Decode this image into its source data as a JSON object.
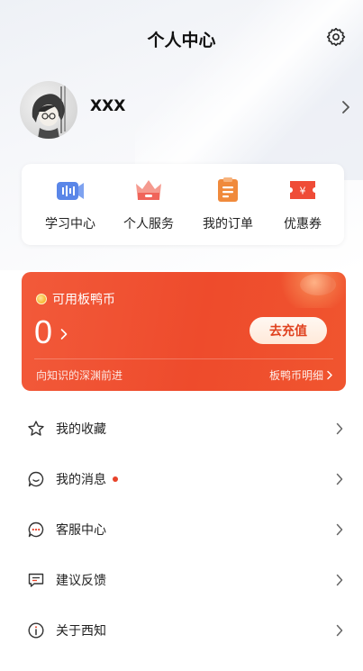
{
  "header": {
    "title": "个人中心",
    "settings_icon": "gear-icon"
  },
  "profile": {
    "username": "XXX"
  },
  "quick_actions": [
    {
      "label": "学习中心",
      "icon": "study-center-icon",
      "color": "#5a86e8"
    },
    {
      "label": "个人服务",
      "icon": "crown-icon",
      "color": "#f0645a"
    },
    {
      "label": "我的订单",
      "icon": "order-list-icon",
      "color": "#f08a3c"
    },
    {
      "label": "优惠券",
      "icon": "coupon-icon",
      "color": "#ef4c37"
    }
  ],
  "coin_card": {
    "title": "可用板鸭币",
    "balance": "0",
    "recharge_label": "去充值",
    "slogan": "向知识的深渊前进",
    "detail_label": "板鸭币明细",
    "accent_color": "#ee4b2c"
  },
  "menu": [
    {
      "label": "我的收藏",
      "icon": "star-icon",
      "badge": false
    },
    {
      "label": "我的消息",
      "icon": "message-icon",
      "badge": true
    },
    {
      "label": "客服中心",
      "icon": "customer-service-icon",
      "badge": false
    },
    {
      "label": "建议反馈",
      "icon": "feedback-icon",
      "badge": false
    },
    {
      "label": "关于西知",
      "icon": "info-icon",
      "badge": false
    }
  ]
}
